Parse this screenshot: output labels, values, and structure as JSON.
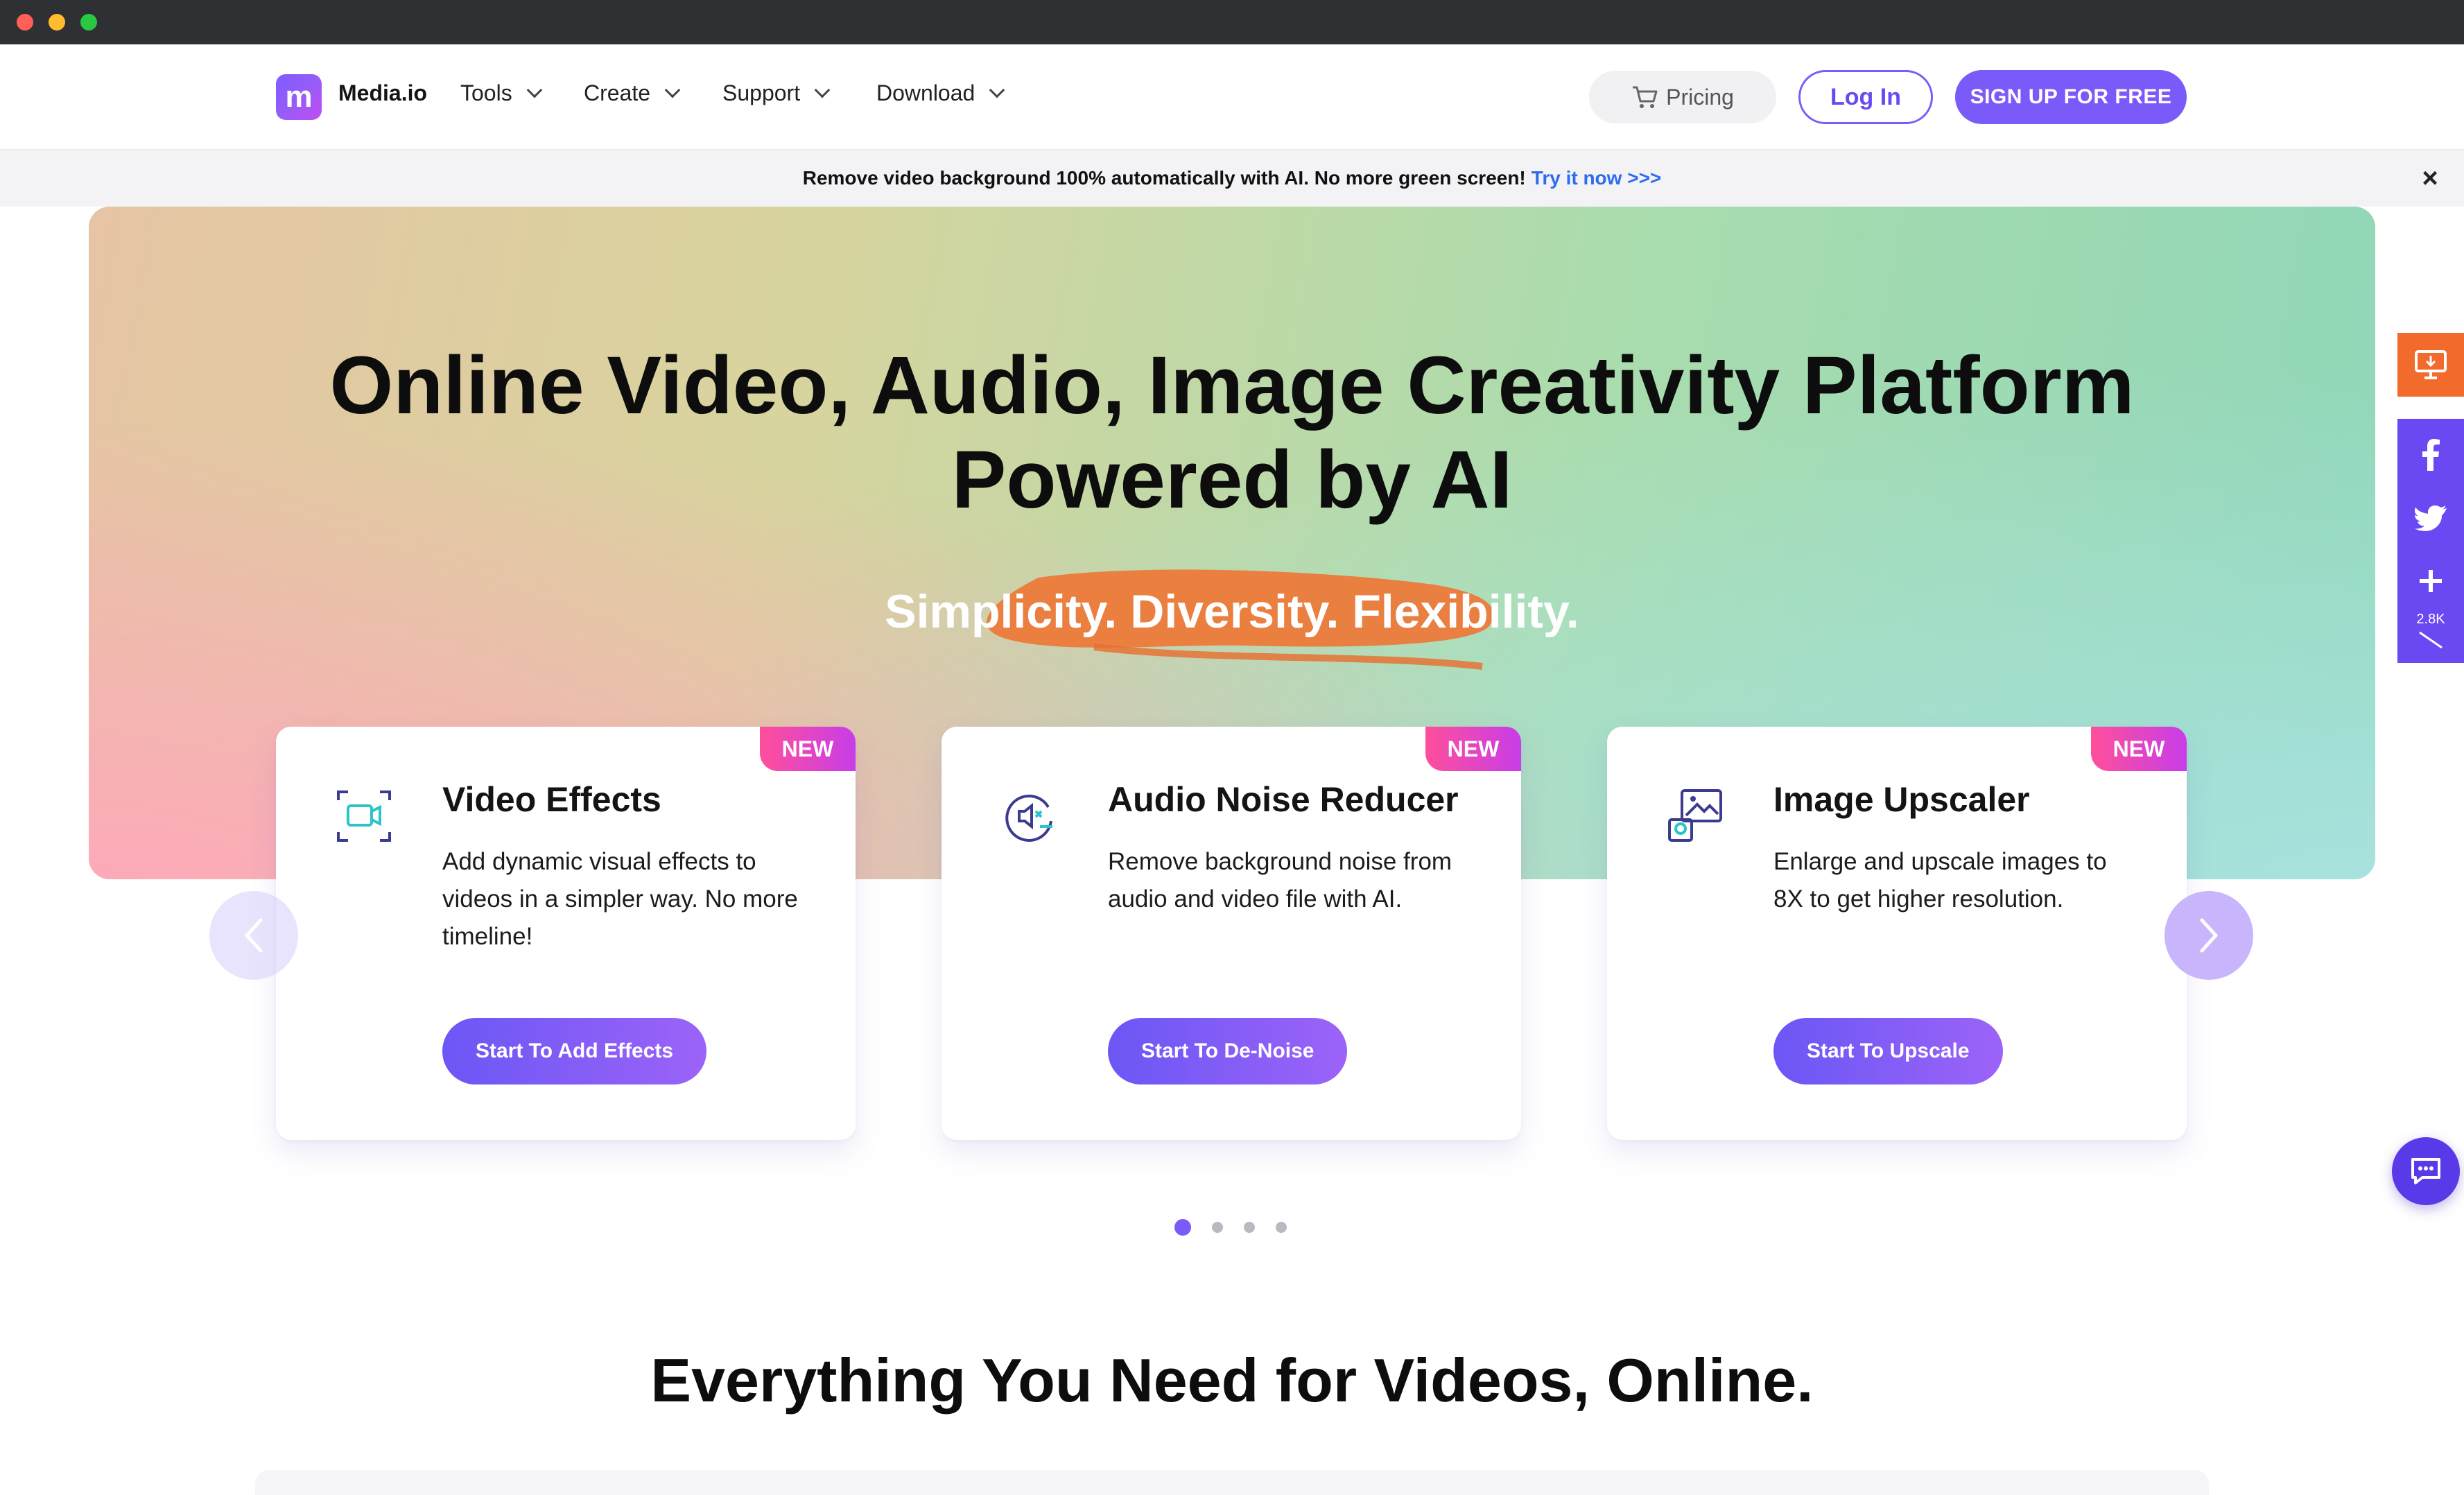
{
  "header": {
    "brand": "Media.io",
    "nav": [
      {
        "label": "Tools"
      },
      {
        "label": "Create"
      },
      {
        "label": "Support"
      },
      {
        "label": "Download"
      }
    ],
    "pricing_label": "Pricing",
    "login_label": "Log In",
    "signup_label": "SIGN UP FOR FREE"
  },
  "announcement": {
    "text": "Remove video background 100% automatically with AI. No more green screen!",
    "link": "Try it now >>>"
  },
  "hero": {
    "title_line1": "Online Video, Audio, Image Creativity Platform",
    "title_line2": "Powered by AI",
    "subtitle": "Simplicity. Diversity. Flexibility."
  },
  "cards": [
    {
      "badge": "NEW",
      "icon": "video-effects-icon",
      "title": "Video Effects",
      "desc": "Add dynamic visual effects to videos in a simpler way. No more timeline!",
      "cta": "Start To Add Effects"
    },
    {
      "badge": "NEW",
      "icon": "audio-noise-icon",
      "title": "Audio Noise Reducer",
      "desc": "Remove background noise from audio and video file with AI.",
      "cta": "Start To De-Noise"
    },
    {
      "badge": "NEW",
      "icon": "image-upscale-icon",
      "title": "Image Upscaler",
      "desc": "Enlarge and upscale images to 8X to get higher resolution.",
      "cta": "Start To Upscale"
    }
  ],
  "carousel": {
    "pages": 4,
    "active": 1
  },
  "section": {
    "title": "Everything You Need for Videos, Online."
  },
  "share": {
    "count": "2.8K"
  },
  "colors": {
    "accent": "#7a5af8",
    "share_orange": "#f26a2c",
    "share_purple": "#6a49f2",
    "badge_pink": "#ff4f9b"
  }
}
